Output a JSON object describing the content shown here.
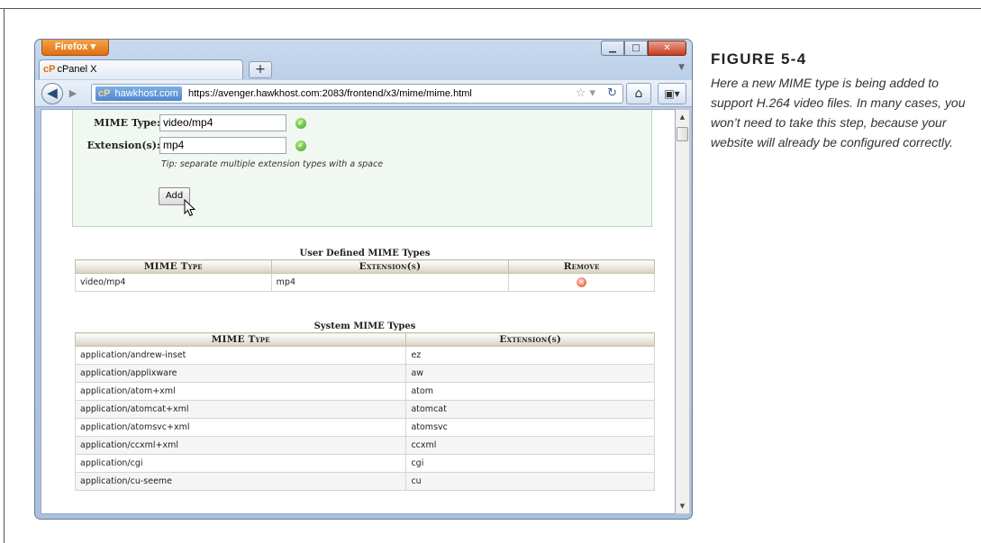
{
  "browser": {
    "app_button": "Firefox ▾",
    "tab_title": "cPanel X",
    "tab_logo": "cP",
    "new_tab": "+",
    "site_identity": "hawkhost.com",
    "url": "https://avenger.hawkhost.com:2083/frontend/x3/mime/mime.html"
  },
  "form": {
    "mime_type_label": "MIME Type:",
    "mime_type_value": "video/mp4",
    "extension_label": "Extension(s):",
    "extension_value": "mp4",
    "tip": "Tip: separate multiple extension types with a space",
    "add_button": "Add"
  },
  "user_defined": {
    "title": "User Defined MIME Types",
    "headers": [
      "MIME Type",
      "Extension(s)",
      "Remove"
    ],
    "rows": [
      {
        "mime": "video/mp4",
        "ext": "mp4"
      }
    ]
  },
  "system": {
    "title": "System MIME Types",
    "headers": [
      "MIME Type",
      "Extension(s)"
    ],
    "rows": [
      {
        "mime": "application/andrew-inset",
        "ext": "ez"
      },
      {
        "mime": "application/applixware",
        "ext": "aw"
      },
      {
        "mime": "application/atom+xml",
        "ext": "atom"
      },
      {
        "mime": "application/atomcat+xml",
        "ext": "atomcat"
      },
      {
        "mime": "application/atomsvc+xml",
        "ext": "atomsvc"
      },
      {
        "mime": "application/ccxml+xml",
        "ext": "ccxml"
      },
      {
        "mime": "application/cgi",
        "ext": "cgi"
      },
      {
        "mime": "application/cu-seeme",
        "ext": "cu"
      }
    ]
  },
  "caption": {
    "title": "FIGURE 5-4",
    "text": "Here a new MIME type is being added to support H.264 video files. In many cases, you won’t need to take this step, because your website will already be configured correctly."
  },
  "colors": {
    "firefox_orange": "#e16f10",
    "panel_green": "#f1f8f1",
    "ok_green": "#3b9e1a",
    "remove_red": "#e5482b"
  }
}
